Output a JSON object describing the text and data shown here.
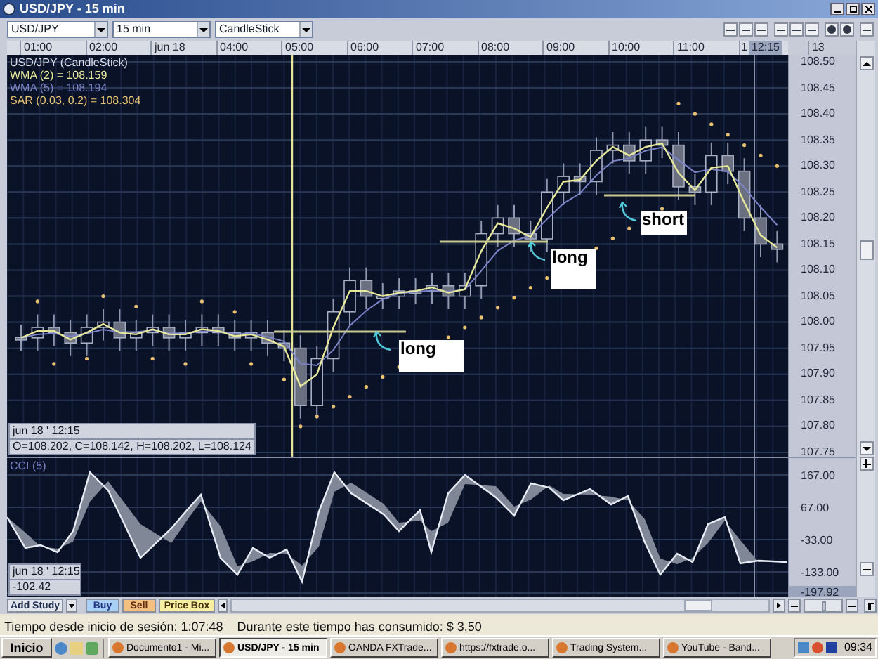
{
  "window": {
    "title": "USD/JPY - 15 min"
  },
  "toolbar": {
    "instrument": "USD/JPY",
    "interval": "15 min",
    "chart_type": "CandleStick"
  },
  "time_axis": [
    {
      "label": "01:00",
      "selected": false
    },
    {
      "label": "02:00",
      "selected": false
    },
    {
      "label": "jun 18",
      "selected": false
    },
    {
      "label": "04:00",
      "selected": false
    },
    {
      "label": "05:00",
      "selected": false
    },
    {
      "label": "06:00",
      "selected": false
    },
    {
      "label": "07:00",
      "selected": false
    },
    {
      "label": "08:00",
      "selected": false
    },
    {
      "label": "09:00",
      "selected": false
    },
    {
      "label": "10:00",
      "selected": false
    },
    {
      "label": "11:00",
      "selected": false
    },
    {
      "label": "1",
      "selected": false
    },
    {
      "label": "12:15",
      "selected": true
    },
    {
      "label": "13",
      "selected": false
    }
  ],
  "price_chart": {
    "legend": [
      {
        "text": "USD/JPY (CandleStick)",
        "color": "#d8dce8"
      },
      {
        "text": "WMA (2) = 108.159",
        "color": "#e8e89a"
      },
      {
        "text": "WMA (5) = 108.194",
        "color": "#7c84c8"
      },
      {
        "text": "SAR (0.03, 0.2) = 108.304",
        "color": "#e8c070"
      }
    ],
    "annotations": [
      {
        "label": "long"
      },
      {
        "label": "long"
      },
      {
        "label": "short"
      }
    ],
    "cursor_box": {
      "time": "jun 18 ' 12:15",
      "values": "O=108.202, C=108.142, H=108.202, L=108.124"
    },
    "price_axis": [
      "108.50",
      "108.45",
      "108.40",
      "108.35",
      "108.30",
      "108.25",
      "108.20",
      "108.15",
      "108.10",
      "108.05",
      "108.00",
      "107.95",
      "107.90",
      "107.85",
      "107.80",
      "107.75"
    ]
  },
  "cci_chart": {
    "label": "CCI (5)",
    "cursor_box": {
      "time": "jun 18 ' 12:15",
      "value": "-102.42"
    },
    "axis": [
      {
        "label": "167.00",
        "selected": false
      },
      {
        "label": "67.00",
        "selected": false
      },
      {
        "label": "-33.00",
        "selected": false
      },
      {
        "label": "-133.00",
        "selected": false
      },
      {
        "label": "-197.92",
        "selected": true
      }
    ]
  },
  "bottom_bar": {
    "zoom": {
      "level": 0.55
    },
    "buttons": [
      {
        "label": "Add Study",
        "kind": "plain"
      },
      {
        "label": "Buy",
        "kind": "buy"
      },
      {
        "label": "Sell",
        "kind": "sell"
      },
      {
        "label": "Price Box",
        "kind": "pricebox"
      }
    ]
  },
  "status_bar": {
    "session_label": "Tiempo desde inicio de sesión:",
    "session_time": "1:07:48",
    "cost_label": "Durante este tiempo has consumido:",
    "cost": "$ 3,50"
  },
  "taskbar": {
    "start": "Inicio",
    "tasks": [
      {
        "label": "Documento1 - Mi...",
        "selected": false
      },
      {
        "label": "USD/JPY - 15 min",
        "selected": true
      },
      {
        "label": "OANDA FXTrade...",
        "selected": false
      },
      {
        "label": "https://fxtrade.o...",
        "selected": false
      },
      {
        "label": "Trading System...",
        "selected": false
      },
      {
        "label": "YouTube - Band...",
        "selected": false
      }
    ],
    "clock": "09:34"
  }
}
